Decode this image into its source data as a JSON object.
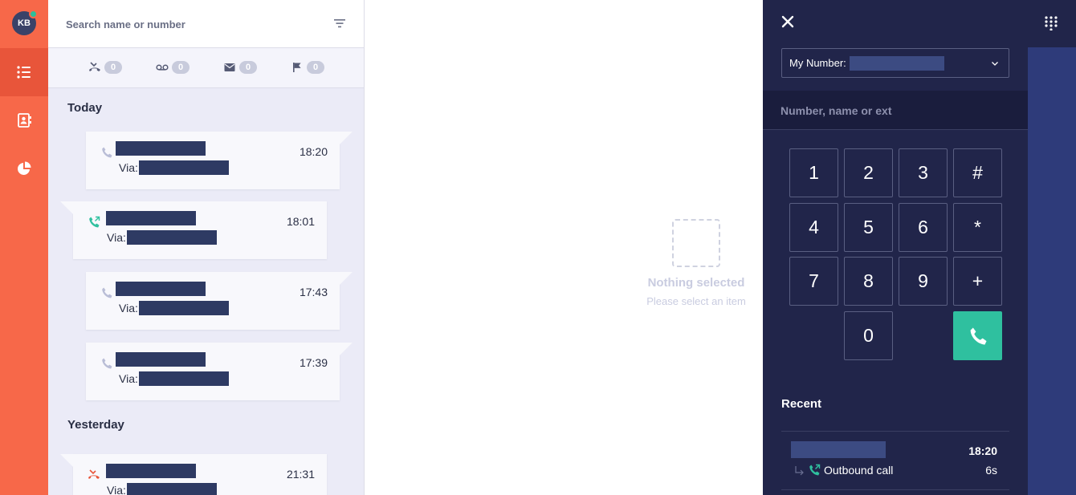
{
  "colors": {
    "brand": "#f76849",
    "dialer_bg": "#21254a",
    "call_green": "#2fc09f",
    "missed_red": "#e8553a",
    "redaction": "#2e3a63"
  },
  "rail": {
    "avatar_initials": "KB",
    "items": [
      {
        "icon": "feed-list-icon",
        "active": true
      },
      {
        "icon": "contacts-book-icon",
        "active": false
      },
      {
        "icon": "analytics-pie-icon",
        "active": false
      }
    ]
  },
  "feed": {
    "search_placeholder": "Search name or number",
    "counters": [
      {
        "icon": "missed-call-icon",
        "count": "0"
      },
      {
        "icon": "voicemail-icon",
        "count": "0"
      },
      {
        "icon": "message-icon",
        "count": "0"
      },
      {
        "icon": "flag-icon",
        "count": "0"
      }
    ],
    "groups": [
      {
        "label": "Today",
        "items": [
          {
            "direction": "in",
            "status": "inbound",
            "via_label": "Via:",
            "time": "18:20"
          },
          {
            "direction": "out",
            "status": "outbound",
            "via_label": "Via:",
            "time": "18:01"
          },
          {
            "direction": "in",
            "status": "inbound",
            "via_label": "Via:",
            "time": "17:43"
          },
          {
            "direction": "in",
            "status": "inbound",
            "via_label": "Via:",
            "time": "17:39"
          }
        ]
      },
      {
        "label": "Yesterday",
        "items": [
          {
            "direction": "out",
            "status": "missed",
            "via_label": "Via:",
            "time": "21:31"
          }
        ]
      }
    ]
  },
  "empty_state": {
    "title": "Nothing selected",
    "subtitle": "Please select an item"
  },
  "dialer": {
    "my_number_label": "My Number:",
    "number_placeholder": "Number, name or ext",
    "keys": [
      "1",
      "2",
      "3",
      "#",
      "4",
      "5",
      "6",
      "*",
      "7",
      "8",
      "9",
      "+",
      "0"
    ],
    "recent_label": "Recent",
    "recent": [
      {
        "time": "18:20",
        "type": "Outbound call",
        "duration": "6s"
      }
    ]
  }
}
